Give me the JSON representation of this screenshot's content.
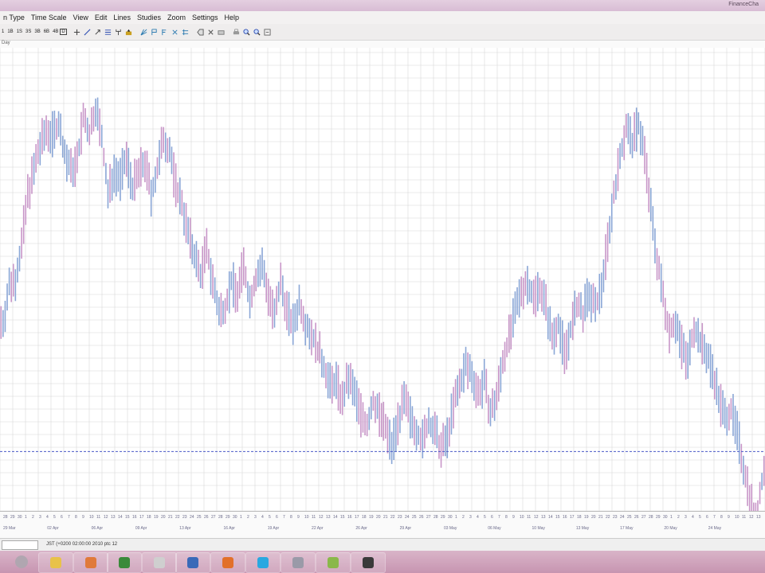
{
  "window": {
    "app_title": "FinanceCha"
  },
  "menubar": {
    "items": [
      {
        "label": "n Type"
      },
      {
        "label": "Time Scale"
      },
      {
        "label": "View"
      },
      {
        "label": "Edit"
      },
      {
        "label": "Lines"
      },
      {
        "label": "Studies"
      },
      {
        "label": "Zoom"
      },
      {
        "label": "Settings"
      },
      {
        "label": "Help"
      }
    ]
  },
  "toolbar": {
    "timeframes": [
      "1",
      "1B",
      "1S",
      "3S",
      "3B",
      "6B",
      "4B"
    ],
    "active": "D",
    "tools": [
      "cross-icon",
      "line-icon",
      "arrow-icon",
      "fibonacci-icon",
      "pitchfork-icon",
      "text-icon",
      "gann-icon",
      "erase-icon",
      "delete-icon",
      "print-icon",
      "zoom-in-icon",
      "zoom-out-icon",
      "settings-icon"
    ]
  },
  "subbar": {
    "label": "Day"
  },
  "chart_data": {
    "type": "ohlc",
    "colors": {
      "up": "#8aa6d6",
      "down": "#c896c8",
      "grid": "#d8d8d8",
      "hline": "#4a5ac8"
    },
    "hline_level": 0.135,
    "ylim": [
      0,
      1
    ],
    "close": [
      0.46,
      0.55,
      0.57,
      0.65,
      0.78,
      0.84,
      0.9,
      0.94,
      0.93,
      0.96,
      0.88,
      0.84,
      0.86,
      0.97,
      0.93,
      1.0,
      0.92,
      0.78,
      0.84,
      0.82,
      0.87,
      0.8,
      0.83,
      0.86,
      0.78,
      0.84,
      0.92,
      0.89,
      0.8,
      0.76,
      0.68,
      0.63,
      0.58,
      0.64,
      0.56,
      0.48,
      0.5,
      0.56,
      0.53,
      0.6,
      0.51,
      0.57,
      0.6,
      0.53,
      0.47,
      0.56,
      0.49,
      0.45,
      0.51,
      0.46,
      0.43,
      0.39,
      0.35,
      0.3,
      0.31,
      0.26,
      0.32,
      0.28,
      0.23,
      0.2,
      0.26,
      0.23,
      0.19,
      0.15,
      0.21,
      0.26,
      0.22,
      0.19,
      0.16,
      0.21,
      0.18,
      0.14,
      0.17,
      0.25,
      0.3,
      0.35,
      0.33,
      0.28,
      0.31,
      0.23,
      0.27,
      0.36,
      0.42,
      0.48,
      0.54,
      0.56,
      0.52,
      0.55,
      0.5,
      0.42,
      0.46,
      0.38,
      0.44,
      0.5,
      0.48,
      0.53,
      0.49,
      0.55,
      0.66,
      0.78,
      0.87,
      0.95,
      0.91,
      0.96,
      0.88,
      0.74,
      0.62,
      0.52,
      0.44,
      0.46,
      0.4,
      0.36,
      0.45,
      0.41,
      0.38,
      0.34,
      0.27,
      0.22,
      0.24,
      0.18,
      0.1,
      0.03,
      -0.05,
      0.06,
      0.13
    ]
  },
  "x_axis": {
    "tick_labels": [
      "28",
      "29",
      "30",
      "1",
      "2",
      "3",
      "4",
      "5",
      "6",
      "7",
      "8",
      "9",
      "10",
      "11",
      "12",
      "13",
      "14",
      "15",
      "16",
      "17",
      "18",
      "19",
      "20",
      "21",
      "22",
      "23",
      "24",
      "25",
      "26",
      "27"
    ],
    "month_labels": [
      "29 Mar",
      "02 Apr",
      "06 Apr",
      "09 Apr",
      "13 Apr",
      "16 Apr",
      "19 Apr",
      "22 Apr",
      "26 Apr",
      "29 Apr",
      "03 May",
      "06 May",
      "10 May",
      "13 May",
      "17 May",
      "20 May",
      "24 May"
    ]
  },
  "status": {
    "text": "JST (+0200  02:00:00  2010  ptc 12"
  },
  "taskbar": {
    "items": [
      {
        "icon": "start-orb-icon",
        "color": "#b0a6b0"
      },
      {
        "icon": "explorer-folder-icon",
        "color": "#e8c24a"
      },
      {
        "icon": "media-player-icon",
        "color": "#e07a3a"
      },
      {
        "icon": "excel-icon",
        "color": "#3a8a3a"
      },
      {
        "icon": "notepad-icon",
        "color": "#cfcfcf"
      },
      {
        "icon": "network-globe-icon",
        "color": "#3a6ab8"
      },
      {
        "icon": "firefox-icon",
        "color": "#e2702a"
      },
      {
        "icon": "skype-icon",
        "color": "#2aa8e0"
      },
      {
        "icon": "chart-app-icon",
        "color": "#9a9aa8"
      },
      {
        "icon": "folder-green-icon",
        "color": "#8ab84a"
      },
      {
        "icon": "trading-app-icon",
        "color": "#3a3a3a"
      }
    ]
  }
}
